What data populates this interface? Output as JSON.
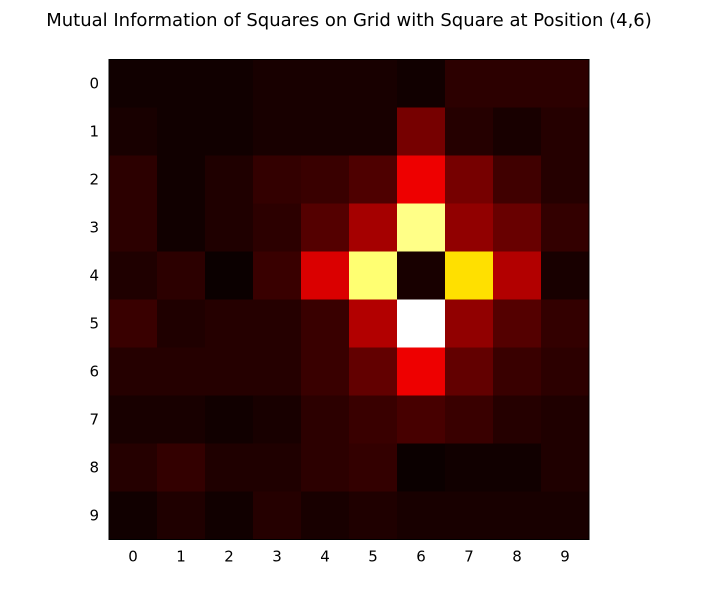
{
  "chart_data": {
    "type": "heatmap",
    "title": "Mutual Information of Squares on Grid with Square at Position (4,6)",
    "xlabel": "",
    "ylabel": "",
    "x_ticks": [
      "0",
      "1",
      "2",
      "3",
      "4",
      "5",
      "6",
      "7",
      "8",
      "9"
    ],
    "y_ticks": [
      "0",
      "1",
      "2",
      "3",
      "4",
      "5",
      "6",
      "7",
      "8",
      "9"
    ],
    "colormap": "hot",
    "grid": false,
    "value_range": [
      0,
      1
    ],
    "values": [
      [
        0.01,
        0.01,
        0.01,
        0.02,
        0.02,
        0.02,
        0.01,
        0.05,
        0.05,
        0.05
      ],
      [
        0.02,
        0.01,
        0.01,
        0.02,
        0.02,
        0.02,
        0.16,
        0.04,
        0.02,
        0.04
      ],
      [
        0.05,
        0.01,
        0.03,
        0.06,
        0.07,
        0.1,
        0.34,
        0.16,
        0.08,
        0.04
      ],
      [
        0.05,
        0.01,
        0.03,
        0.05,
        0.11,
        0.23,
        0.88,
        0.2,
        0.14,
        0.06
      ],
      [
        0.03,
        0.05,
        0.0,
        0.07,
        0.31,
        0.86,
        0.02,
        0.7,
        0.25,
        0.02
      ],
      [
        0.07,
        0.03,
        0.04,
        0.04,
        0.07,
        0.25,
        1.0,
        0.2,
        0.11,
        0.06
      ],
      [
        0.04,
        0.04,
        0.04,
        0.04,
        0.07,
        0.13,
        0.34,
        0.13,
        0.07,
        0.05
      ],
      [
        0.02,
        0.02,
        0.01,
        0.02,
        0.05,
        0.07,
        0.09,
        0.07,
        0.04,
        0.03
      ],
      [
        0.04,
        0.06,
        0.03,
        0.03,
        0.05,
        0.06,
        0.0,
        0.01,
        0.01,
        0.03
      ],
      [
        0.01,
        0.03,
        0.01,
        0.04,
        0.02,
        0.03,
        0.02,
        0.02,
        0.02,
        0.02
      ]
    ]
  }
}
